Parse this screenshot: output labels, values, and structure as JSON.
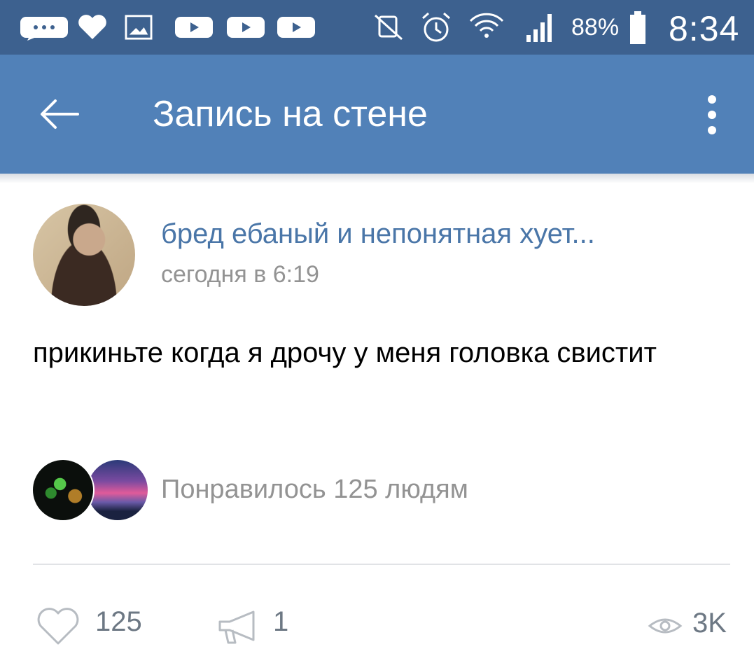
{
  "status_bar": {
    "notification_icons": [
      "messages-icon",
      "heart-icon",
      "gallery-icon",
      "video-icon",
      "video-icon",
      "video-icon"
    ],
    "system_icons": [
      "vibrate-off-icon",
      "alarm-icon",
      "wifi-icon",
      "signal-icon"
    ],
    "battery": "88%",
    "time": "8:34"
  },
  "header": {
    "back_icon": "arrow-left-icon",
    "title": "Запись на стене",
    "menu_icon": "more-vertical-icon"
  },
  "post": {
    "author": "бред ебаный и непонятная хует...",
    "time": "сегодня в 6:19",
    "text": "прикиньте когда я дрочу у меня головка свистит",
    "likes_summary": "Понравилось 125 людям"
  },
  "actions": {
    "likes": "125",
    "reposts": "1",
    "views": "3K"
  },
  "colors": {
    "status_bar": "#3d618f",
    "header": "#5181b8",
    "link": "#4a76a8",
    "secondary_text": "#939393",
    "action_gray": "#6d7884"
  }
}
